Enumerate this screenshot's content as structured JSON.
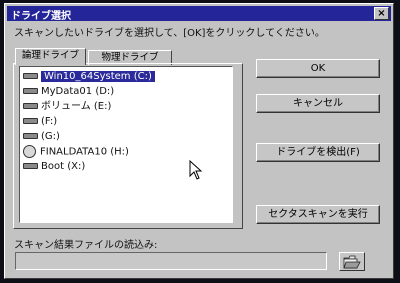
{
  "window": {
    "title": "ドライブ選択",
    "close_glyph": "×",
    "instruction": "スキャンしたいドライブを選択して、[OK]をクリックしてください。"
  },
  "tabs": [
    {
      "label": "論理ドライブ",
      "active": true
    },
    {
      "label": "物理ドライブ",
      "active": false
    }
  ],
  "drives": [
    {
      "label": "Win10_64System (C:)",
      "icon": "hard-drive-icon",
      "selected": true
    },
    {
      "label": "MyData01 (D:)",
      "icon": "hard-drive-icon",
      "selected": false
    },
    {
      "label": "ボリューム (E:)",
      "icon": "hard-drive-icon",
      "selected": false
    },
    {
      "label": "(F:)",
      "icon": "hard-drive-icon",
      "selected": false
    },
    {
      "label": "(G:)",
      "icon": "hard-drive-icon",
      "selected": false
    },
    {
      "label": "FINALDATA10 (H:)",
      "icon": "cd-drive-icon",
      "selected": false
    },
    {
      "label": "Boot (X:)",
      "icon": "hard-drive-icon",
      "selected": false
    }
  ],
  "buttons": {
    "ok": "OK",
    "cancel": "キャンセル",
    "detect": "ドライブを検出(F)",
    "sector_scan": "セクタスキャンを実行"
  },
  "result_file": {
    "label": "スキャン結果ファイルの読込み:",
    "value": "",
    "browse_icon": "folder-open-icon"
  },
  "colors": {
    "titlebar": "#25259a",
    "selection": "#2a2a9a",
    "face": "#c3c3c3"
  }
}
